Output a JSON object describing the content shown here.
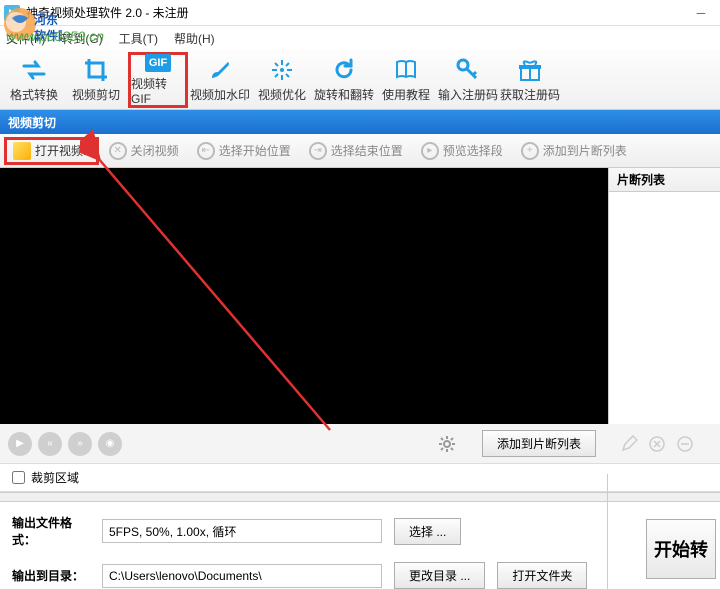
{
  "title": "神奇视频处理软件 2.0 - 未注册",
  "watermark": {
    "text": "河东软件园",
    "url": "www.pc0359.cn"
  },
  "menu": {
    "file": "文件(F)",
    "goto": "转到(G)",
    "tool": "工具(T)",
    "help": "帮助(H)"
  },
  "toolbar": [
    {
      "label": "格式转换"
    },
    {
      "label": "视频剪切"
    },
    {
      "label": "视频转GIF"
    },
    {
      "label": "视频加水印"
    },
    {
      "label": "视频优化"
    },
    {
      "label": "旋转和翻转"
    },
    {
      "label": "使用教程"
    },
    {
      "label": "输入注册码"
    },
    {
      "label": "获取注册码"
    }
  ],
  "band": "视频剪切",
  "actions": {
    "open": "打开视频..",
    "close": "关闭视频",
    "start": "选择开始位置",
    "end": "选择结束位置",
    "preview": "预览选择段",
    "add": "添加到片断列表"
  },
  "side": {
    "header": "片断列表",
    "addbtn": "添加到片断列表"
  },
  "crop": {
    "label": "裁剪区域"
  },
  "output": {
    "fmt_label": "输出文件格式：",
    "fmt_value": "5FPS, 50%, 1.00x, 循环",
    "fmt_btn": "选择 ...",
    "dir_label": "输出到目录：",
    "dir_value": "C:\\Users\\lenovo\\Documents\\",
    "dir_btn": "更改目录 ...",
    "open_btn": "打开文件夹"
  },
  "start_btn": "开始转"
}
